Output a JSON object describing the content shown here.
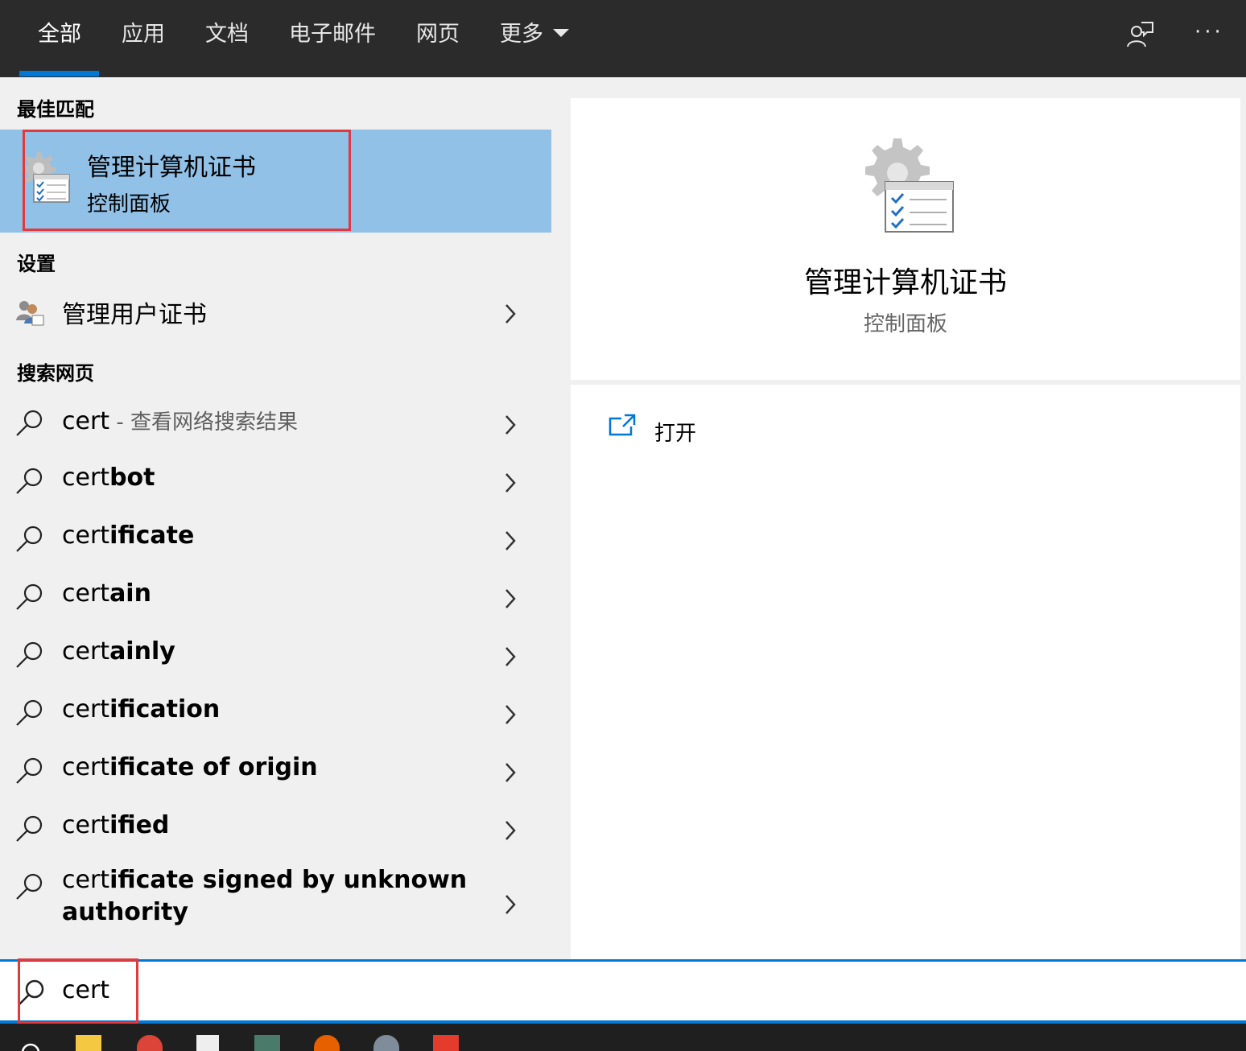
{
  "tabs": [
    {
      "label": "全部"
    },
    {
      "label": "应用"
    },
    {
      "label": "文档"
    },
    {
      "label": "电子邮件"
    },
    {
      "label": "网页"
    },
    {
      "label": "更多"
    }
  ],
  "header": {
    "feedback_icon": "feedback-icon",
    "more_icon": "ellipsis-icon"
  },
  "sections": {
    "best_match": "最佳匹配",
    "settings": "设置",
    "web": "搜索网页"
  },
  "best_match": {
    "title": "管理计算机证书",
    "subtitle": "控制面板",
    "icon": "certificate-manager-icon"
  },
  "settings_items": [
    {
      "label": "管理用户证书",
      "icon": "users-certificate-icon"
    }
  ],
  "web_results": [
    {
      "typed": "cert",
      "rest": "",
      "suffix": " - 查看网络搜索结果"
    },
    {
      "typed": "cert",
      "rest": "bot",
      "suffix": ""
    },
    {
      "typed": "cert",
      "rest": "ificate",
      "suffix": ""
    },
    {
      "typed": "cert",
      "rest": "ain",
      "suffix": ""
    },
    {
      "typed": "cert",
      "rest": "ainly",
      "suffix": ""
    },
    {
      "typed": "cert",
      "rest": "ification",
      "suffix": ""
    },
    {
      "typed": "cert",
      "rest": "ificate of origin",
      "suffix": ""
    },
    {
      "typed": "cert",
      "rest": "ified",
      "suffix": ""
    },
    {
      "typed": "cert",
      "rest": "ificate signed by unknown",
      "rest2": "authority",
      "suffix": ""
    }
  ],
  "detail": {
    "title": "管理计算机证书",
    "subtitle": "控制面板",
    "action_label": "打开"
  },
  "search": {
    "value": "cert"
  },
  "colors": {
    "accent": "#0078d7",
    "selection": "#91c1e7",
    "highlight_box": "#e0393e",
    "topbar": "#2b2b2b"
  }
}
